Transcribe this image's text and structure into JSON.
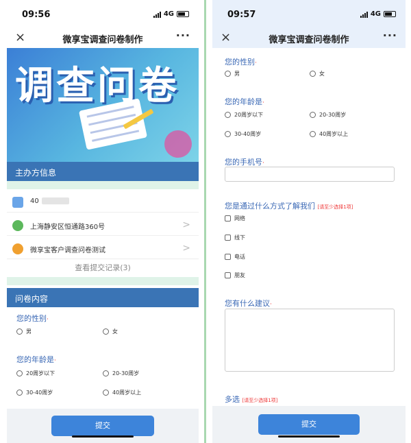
{
  "left": {
    "status": {
      "time": "09:56",
      "network": "4G"
    },
    "nav": {
      "close": "×",
      "title": "微享宝调查问卷制作",
      "more": "···"
    },
    "banner_text": "调查问卷",
    "organizer_title": "主办方信息",
    "phone_prefix": "40",
    "address": "上海静安区恒通路360号",
    "survey_name": "微享宝客户调查问卷测试",
    "records": "查看提交记录(3)",
    "content_title": "问卷内容",
    "gender": {
      "label": "您的性别",
      "options": [
        "男",
        "女"
      ]
    },
    "age": {
      "label": "您的年龄是",
      "options": [
        "20周岁以下",
        "20-30周岁",
        "30-40周岁",
        "40周岁以上"
      ]
    },
    "submit": "提交"
  },
  "right": {
    "status": {
      "time": "09:57",
      "network": "4G"
    },
    "nav": {
      "close": "×",
      "title": "微享宝调查问卷制作",
      "more": "···"
    },
    "gender": {
      "label": "您的性别",
      "options": [
        "男",
        "女"
      ]
    },
    "age": {
      "label": "您的年龄是",
      "options": [
        "20周岁以下",
        "20-30周岁",
        "30-40周岁",
        "40周岁以上"
      ]
    },
    "phone_label": "您的手机号",
    "channel": {
      "label": "您是通过什么方式了解我们",
      "tip": "[请至少选择1项]",
      "options": [
        "网络",
        "线下",
        "电话",
        "朋友"
      ]
    },
    "suggestion_label": "您有什么建议",
    "multi": {
      "label": "多选",
      "tip": "[请至少选择1项]"
    },
    "submit": "提交"
  },
  "colors": {
    "accent": "#3d84da",
    "section_bar": "#3a74b5",
    "question": "#3a68b5",
    "required": "#ee3333"
  }
}
